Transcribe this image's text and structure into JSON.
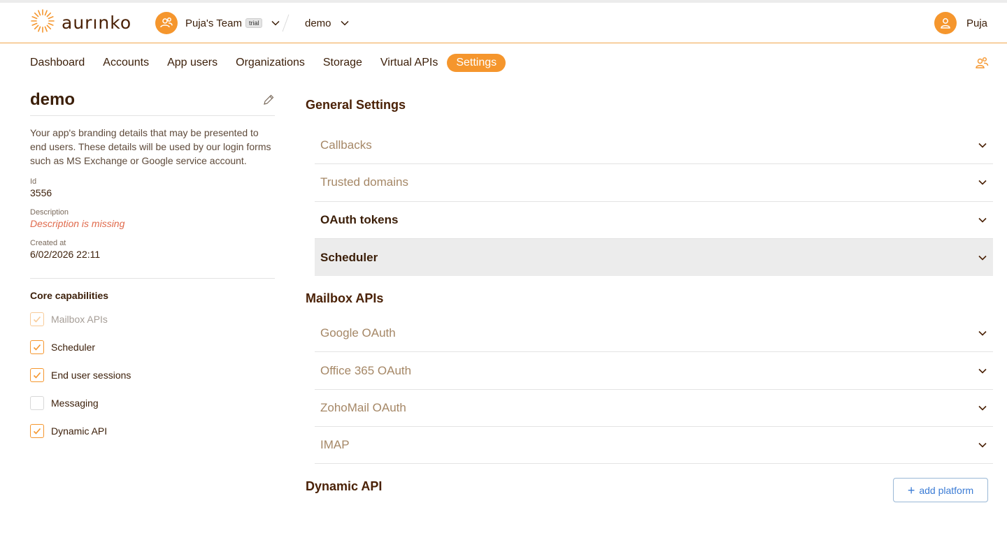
{
  "header": {
    "logo_text": "aurınko",
    "team_name": "Puja's Team",
    "team_badge": "trial",
    "app_name": "demo",
    "user_name": "Puja",
    "icons": [
      "logo-sunburst-icon",
      "team-people-icon",
      "chevron-down-icon",
      "user-icon"
    ]
  },
  "nav": {
    "items": [
      {
        "label": "Dashboard"
      },
      {
        "label": "Accounts"
      },
      {
        "label": "App users"
      },
      {
        "label": "Organizations"
      },
      {
        "label": "Storage"
      },
      {
        "label": "Virtual APIs"
      },
      {
        "label": "Settings"
      }
    ],
    "active": "Settings",
    "right_icon": "people-icon"
  },
  "app": {
    "title": "demo",
    "branding_text": "Your app's branding details that may be presented to end users. These details will be used by our login forms such as MS Exchange or Google service account.",
    "id_label": "Id",
    "id_value": "3556",
    "description_label": "Description",
    "description_value": "Description is missing",
    "created_label": "Created at",
    "created_value": "6/02/2026 22:11"
  },
  "core": {
    "title": "Core capabilities",
    "items": [
      {
        "label": "Mailbox APIs",
        "checked": true,
        "disabled": true
      },
      {
        "label": "Scheduler",
        "checked": true,
        "disabled": false
      },
      {
        "label": "End user sessions",
        "checked": true,
        "disabled": false
      },
      {
        "label": "Messaging",
        "checked": false,
        "disabled": false
      },
      {
        "label": "Dynamic API",
        "checked": true,
        "disabled": false
      }
    ]
  },
  "general": {
    "title": "General Settings",
    "items": [
      {
        "label": "Callbacks"
      },
      {
        "label": "Trusted domains"
      },
      {
        "label": "OAuth tokens"
      },
      {
        "label": "Scheduler"
      }
    ]
  },
  "mailbox": {
    "title": "Mailbox APIs",
    "items": [
      {
        "label": "Google OAuth"
      },
      {
        "label": "Office 365 OAuth"
      },
      {
        "label": "ZohoMail OAuth"
      },
      {
        "label": "IMAP"
      }
    ]
  },
  "dynamic": {
    "title": "Dynamic API",
    "add_label": "add platform"
  },
  "colors": {
    "accent": "#f5962d",
    "text_dark": "#3b1e08",
    "text_muted": "#a58766",
    "error": "#e06a4c",
    "link_blue": "#3a7bd5",
    "highlight_row": "#ececec"
  }
}
